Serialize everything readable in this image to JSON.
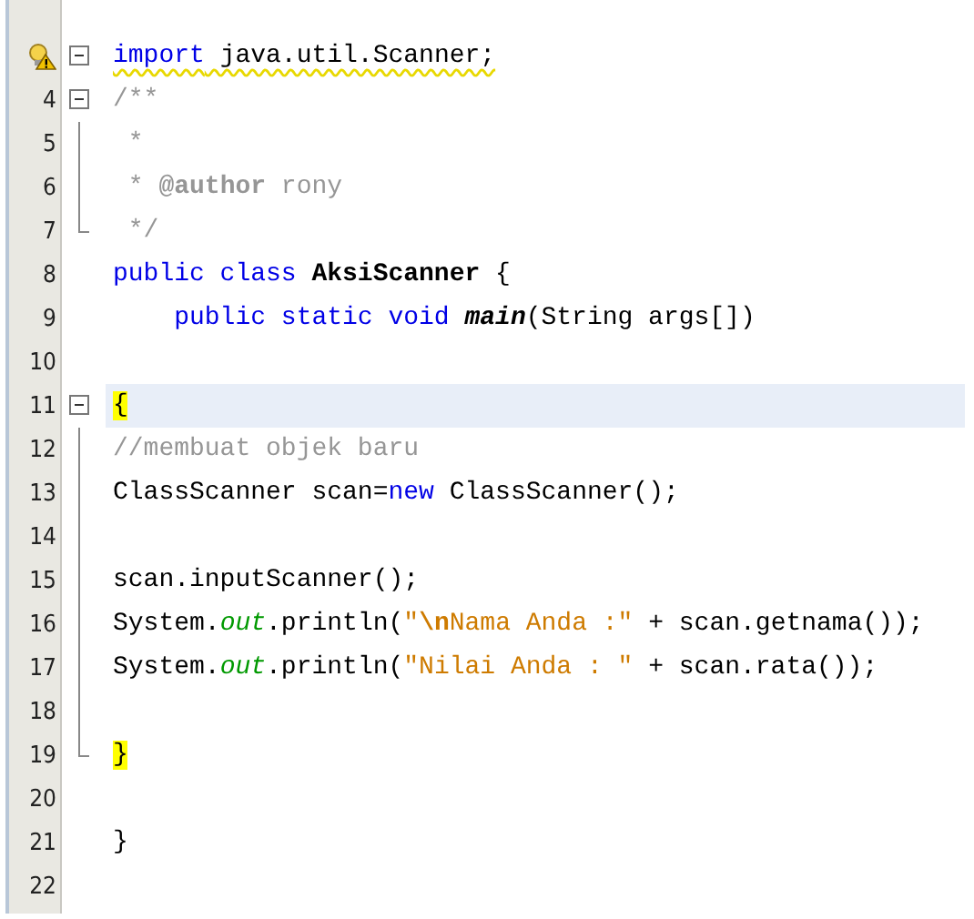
{
  "editor": {
    "lines": [
      {
        "kind": "fold-start",
        "hint": true,
        "warning": true,
        "tokens": [
          {
            "kind": "keyword",
            "text": "import"
          },
          {
            "kind": "plain",
            "text": " java.util.Scanner;"
          }
        ]
      },
      {
        "number": "4",
        "kind": "fold-start",
        "tokens": [
          {
            "kind": "comment",
            "text": "/**"
          }
        ]
      },
      {
        "number": "5",
        "kind": "fold-body",
        "tokens": [
          {
            "kind": "comment",
            "text": " *"
          }
        ]
      },
      {
        "number": "6",
        "kind": "fold-body",
        "tokens": [
          {
            "kind": "comment",
            "text": " * "
          },
          {
            "kind": "doctag",
            "text": "@author"
          },
          {
            "kind": "comment",
            "text": " rony"
          }
        ]
      },
      {
        "number": "7",
        "kind": "fold-end",
        "tokens": [
          {
            "kind": "comment",
            "text": " */"
          }
        ]
      },
      {
        "number": "8",
        "kind": "plain",
        "tokens": [
          {
            "kind": "keyword",
            "text": "public class "
          },
          {
            "kind": "classname",
            "text": "AksiScanner"
          },
          {
            "kind": "plain",
            "text": " {"
          }
        ]
      },
      {
        "number": "9",
        "kind": "plain",
        "tokens": [
          {
            "kind": "keyword",
            "text": "    public static void "
          },
          {
            "kind": "method",
            "text": "main"
          },
          {
            "kind": "plain",
            "text": "(String args[])"
          }
        ]
      },
      {
        "number": "10",
        "kind": "plain"
      },
      {
        "number": "11",
        "kind": "fold-start",
        "current": true,
        "tokens": [
          {
            "kind": "brace",
            "text": "{"
          }
        ]
      },
      {
        "number": "12",
        "kind": "fold-body",
        "tokens": [
          {
            "kind": "comment",
            "text": "//membuat objek baru"
          }
        ]
      },
      {
        "number": "13",
        "kind": "fold-body",
        "tokens": [
          {
            "kind": "plain",
            "text": "ClassScanner scan="
          },
          {
            "kind": "keyword",
            "text": "new"
          },
          {
            "kind": "plain",
            "text": " ClassScanner();"
          }
        ]
      },
      {
        "number": "14",
        "kind": "fold-body"
      },
      {
        "number": "15",
        "kind": "fold-body",
        "tokens": [
          {
            "kind": "plain",
            "text": "scan.inputScanner();"
          }
        ]
      },
      {
        "number": "16",
        "kind": "fold-body",
        "tokens": [
          {
            "kind": "plain",
            "text": "System."
          },
          {
            "kind": "field",
            "text": "out"
          },
          {
            "kind": "plain",
            "text": ".println("
          },
          {
            "kind": "string",
            "text": "\""
          },
          {
            "kind": "escape",
            "text": "\\n"
          },
          {
            "kind": "string",
            "text": "Nama Anda :\""
          },
          {
            "kind": "plain",
            "text": " + scan.getnama());"
          }
        ]
      },
      {
        "number": "17",
        "kind": "fold-body",
        "tokens": [
          {
            "kind": "plain",
            "text": "System."
          },
          {
            "kind": "field",
            "text": "out"
          },
          {
            "kind": "plain",
            "text": ".println("
          },
          {
            "kind": "string",
            "text": "\"Nilai Anda : \""
          },
          {
            "kind": "plain",
            "text": " + scan.rata());"
          }
        ]
      },
      {
        "number": "18",
        "kind": "fold-body"
      },
      {
        "number": "19",
        "kind": "fold-end",
        "tokens": [
          {
            "kind": "brace",
            "text": "}"
          }
        ]
      },
      {
        "number": "20",
        "kind": "plain"
      },
      {
        "number": "21",
        "kind": "plain",
        "tokens": [
          {
            "kind": "plain",
            "text": "}"
          }
        ]
      },
      {
        "number": "22",
        "kind": "plain"
      }
    ]
  }
}
